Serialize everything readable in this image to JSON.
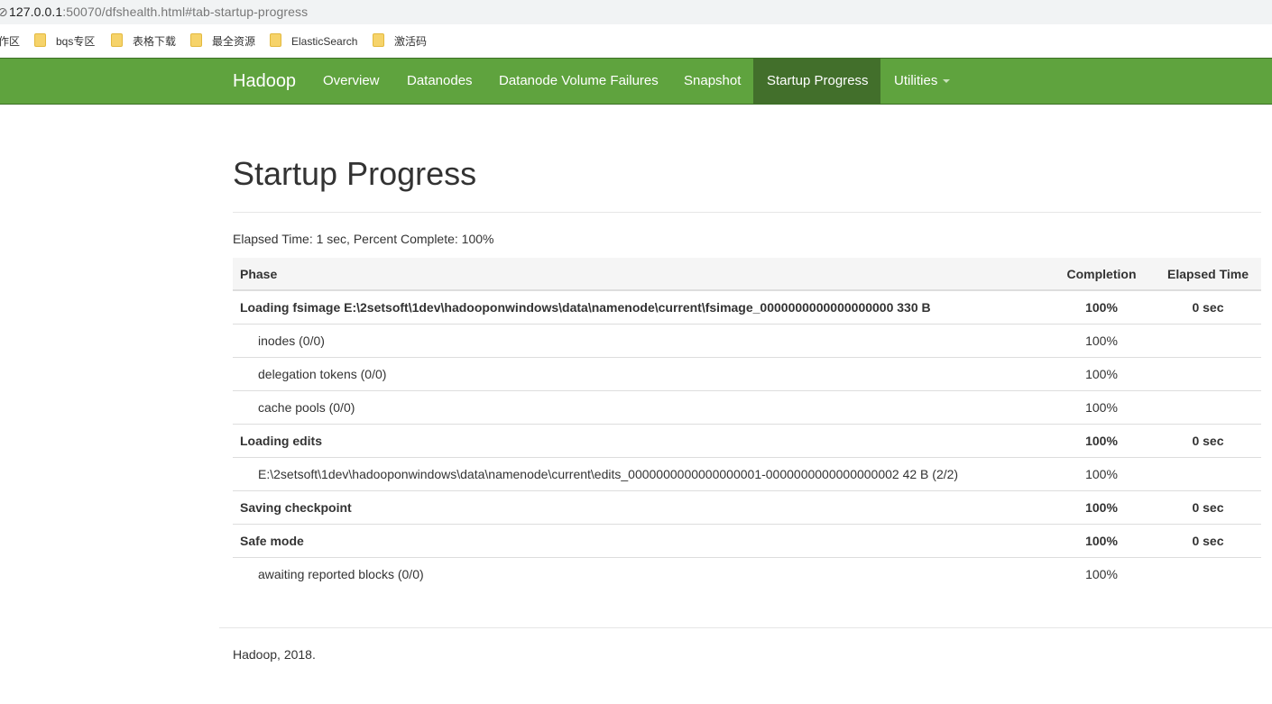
{
  "browser": {
    "address_glyph": "⊘",
    "url_host": "127.0.0.1",
    "url_rest": ":50070/dfshealth.html#tab-startup-progress"
  },
  "bookmarks": [
    {
      "label": "作区"
    },
    {
      "label": "bqs专区"
    },
    {
      "label": "表格下载"
    },
    {
      "label": "最全资源"
    },
    {
      "label": "ElasticSearch"
    },
    {
      "label": "激活码"
    }
  ],
  "navbar": {
    "brand": "Hadoop",
    "links": [
      {
        "label": "Overview"
      },
      {
        "label": "Datanodes"
      },
      {
        "label": "Datanode Volume Failures"
      },
      {
        "label": "Snapshot"
      },
      {
        "label": "Startup Progress"
      },
      {
        "label": "Utilities"
      }
    ],
    "colors": {
      "bar": "#5fa33e",
      "active": "#426f2b"
    }
  },
  "page": {
    "title": "Startup Progress",
    "elapsed": "Elapsed Time: 1 sec, Percent Complete: 100%"
  },
  "table": {
    "headers": {
      "phase": "Phase",
      "completion": "Completion",
      "elapsed": "Elapsed Time"
    },
    "rows": [
      {
        "phase": "Loading fsimage E:\\2setsoft\\1dev\\hadooponwindows\\data\\namenode\\current\\fsimage_0000000000000000000 330 B",
        "completion": "100%",
        "elapsed": "0 sec"
      },
      {
        "phase": "inodes (0/0)",
        "completion": "100%",
        "elapsed": ""
      },
      {
        "phase": "delegation tokens (0/0)",
        "completion": "100%",
        "elapsed": ""
      },
      {
        "phase": "cache pools (0/0)",
        "completion": "100%",
        "elapsed": ""
      },
      {
        "phase": "Loading edits",
        "completion": "100%",
        "elapsed": "0 sec"
      },
      {
        "phase": "E:\\2setsoft\\1dev\\hadooponwindows\\data\\namenode\\current\\edits_0000000000000000001-0000000000000000002 42 B (2/2)",
        "completion": "100%",
        "elapsed": ""
      },
      {
        "phase": "Saving checkpoint",
        "completion": "100%",
        "elapsed": "0 sec"
      },
      {
        "phase": "Safe mode",
        "completion": "100%",
        "elapsed": "0 sec"
      },
      {
        "phase": "awaiting reported blocks (0/0)",
        "completion": "100%",
        "elapsed": ""
      }
    ]
  },
  "footer": {
    "text": "Hadoop, 2018."
  }
}
